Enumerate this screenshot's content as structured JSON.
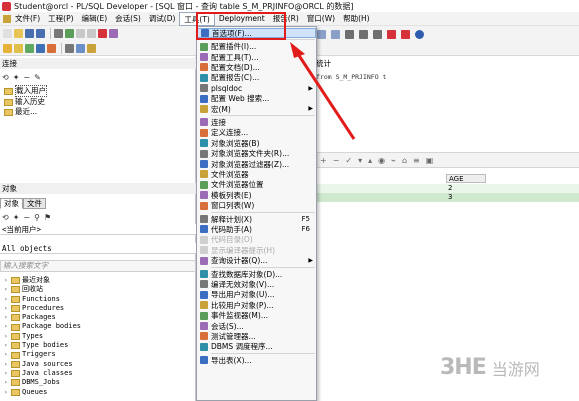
{
  "window": {
    "title": "Student@orcl - PL/SQL Developer - [SQL 窗口 - 查询 table S_M_PRJINFO@ORCL 的数据]"
  },
  "menubar": {
    "items": [
      {
        "label": "文件(F)"
      },
      {
        "label": "工程(P)"
      },
      {
        "label": "编辑(E)"
      },
      {
        "label": "会话(S)"
      },
      {
        "label": "调试(D)"
      },
      {
        "label": "工具(T)"
      },
      {
        "label": "Deployment"
      },
      {
        "label": "报告(R)"
      },
      {
        "label": "窗口(W)"
      },
      {
        "label": "帮助(H)"
      }
    ],
    "selected": "工具(T)"
  },
  "left_panel": {
    "history_header": "连接",
    "history_items": [
      {
        "label": "载入用户"
      },
      {
        "label": "输入历史"
      },
      {
        "label": "最近..."
      }
    ],
    "objects_header": "对象",
    "tabs": [
      {
        "label": "对象"
      },
      {
        "label": "文件"
      }
    ],
    "current_user": "<当前用户>",
    "all_objects": "All objects",
    "search_placeholder": "输入搜索文字",
    "object_tree": [
      {
        "label": "最近对象"
      },
      {
        "label": "回收站"
      },
      {
        "label": "Functions"
      },
      {
        "label": "Procedures"
      },
      {
        "label": "Packages"
      },
      {
        "label": "Package bodies"
      },
      {
        "label": "Types"
      },
      {
        "label": "Type bodies"
      },
      {
        "label": "Triggers"
      },
      {
        "label": "Java sources"
      },
      {
        "label": "Java classes"
      },
      {
        "label": "DBMS_Jobs"
      },
      {
        "label": "Queues"
      }
    ]
  },
  "editor": {
    "subtabs": [
      {
        "label": "统计"
      }
    ],
    "sql": "from S_M_PRJINFO t",
    "grid": {
      "column": "AGE",
      "rows": [
        "2",
        "3"
      ]
    }
  },
  "tools_menu": {
    "items": [
      {
        "label": "首选项(F)...",
        "highlight": true
      },
      {
        "sep": true
      },
      {
        "label": "配置插件(I)..."
      },
      {
        "label": "配置工具(T)..."
      },
      {
        "label": "配置文档(D)..."
      },
      {
        "label": "配置报告(C)..."
      },
      {
        "label": "plsqldoc",
        "submenu": true
      },
      {
        "label": "配置 Web 搜索..."
      },
      {
        "label": "宏(M)",
        "submenu": true
      },
      {
        "sep": true
      },
      {
        "label": "连接"
      },
      {
        "label": "定义连接..."
      },
      {
        "label": "对象浏览器(B)"
      },
      {
        "label": "对象浏览器文件夹(R)..."
      },
      {
        "label": "对象浏览器过滤器(Z)..."
      },
      {
        "label": "文件浏览器"
      },
      {
        "label": "文件浏览器位置"
      },
      {
        "label": "模板列表(E)"
      },
      {
        "label": "窗口列表(W)"
      },
      {
        "sep": true
      },
      {
        "label": "解释计划(X)",
        "shortcut": "F5"
      },
      {
        "label": "代码助手(A)",
        "shortcut": "F6"
      },
      {
        "label": "代码目录(O)",
        "disabled": true
      },
      {
        "label": "显示编译器提示(H)",
        "disabled": true
      },
      {
        "label": "查询设计器(Q)...",
        "submenu": true
      },
      {
        "sep": true
      },
      {
        "label": "查找数据库对象(D)..."
      },
      {
        "label": "编译无效对象(V)..."
      },
      {
        "label": "导出用户对象(U)..."
      },
      {
        "label": "比较用户对象(P)..."
      },
      {
        "label": "事件监视器(M)..."
      },
      {
        "label": "会话(S)..."
      },
      {
        "label": "测试管理器..."
      },
      {
        "label": "DBMS 调度程序..."
      },
      {
        "sep": true
      },
      {
        "label": "导出表(X)..."
      }
    ]
  },
  "annotation": {
    "color": "#e21b1b"
  },
  "watermark": {
    "logo": "3HE",
    "site": "当游网"
  }
}
